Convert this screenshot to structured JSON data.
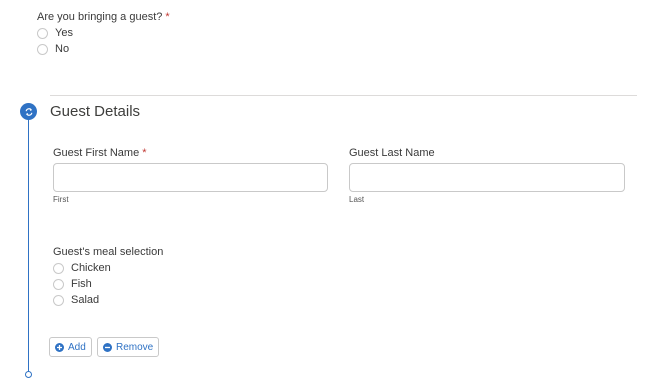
{
  "bringing_guest": {
    "question": "Are you bringing a guest?",
    "required_marker": "*",
    "options": [
      "Yes",
      "No"
    ]
  },
  "guest_section": {
    "title": "Guest Details",
    "first_name": {
      "label": "Guest First Name",
      "required_marker": "*",
      "value": "",
      "sublabel": "First"
    },
    "last_name": {
      "label": "Guest Last Name",
      "value": "",
      "sublabel": "Last"
    },
    "meal": {
      "label": "Guest's meal selection",
      "options": [
        "Chicken",
        "Fish",
        "Salad"
      ]
    },
    "add_label": "Add",
    "remove_label": "Remove"
  },
  "colors": {
    "accent": "#2f72c4",
    "required": "#c23934",
    "border": "#c9c9c9"
  },
  "icons": {
    "section_node": "repeat-icon",
    "add": "plus-circle-icon",
    "remove": "minus-circle-icon"
  }
}
